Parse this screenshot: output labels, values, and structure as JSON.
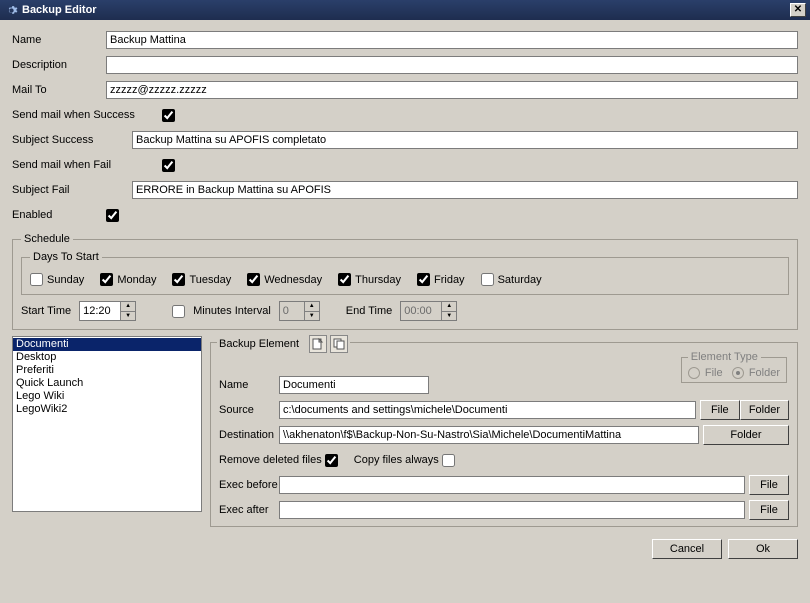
{
  "window": {
    "title": "Backup Editor"
  },
  "form": {
    "name_label": "Name",
    "name_value": "Backup Mattina",
    "desc_label": "Description",
    "desc_value": "",
    "mailto_label": "Mail To",
    "mailto_value": "zzzzz@zzzzz.zzzzz",
    "send_success_label": "Send mail when Success",
    "send_success_checked": true,
    "subject_success_label": "Subject Success",
    "subject_success_value": "Backup Mattina su APOFIS completato",
    "send_fail_label": "Send mail when Fail",
    "send_fail_checked": true,
    "subject_fail_label": "Subject Fail",
    "subject_fail_value": "ERRORE in Backup Mattina su APOFIS",
    "enabled_label": "Enabled",
    "enabled_checked": true
  },
  "schedule": {
    "legend": "Schedule",
    "days_legend": "Days To Start",
    "days": [
      {
        "label": "Sunday",
        "checked": false
      },
      {
        "label": "Monday",
        "checked": true
      },
      {
        "label": "Tuesday",
        "checked": true
      },
      {
        "label": "Wednesday",
        "checked": true
      },
      {
        "label": "Thursday",
        "checked": true
      },
      {
        "label": "Friday",
        "checked": true
      },
      {
        "label": "Saturday",
        "checked": false
      }
    ],
    "start_time_label": "Start Time",
    "start_time_value": "12:20",
    "minutes_interval_label": "Minutes Interval",
    "minutes_interval_value": "0",
    "minutes_interval_enabled": false,
    "end_time_label": "End Time",
    "end_time_value": "00:00",
    "end_time_enabled": false
  },
  "list": {
    "items": [
      "Documenti",
      "Desktop",
      "Preferiti",
      "Quick Launch",
      "Lego Wiki",
      "LegoWiki2"
    ],
    "selected_index": 0
  },
  "backup_element": {
    "legend": "Backup Element",
    "name_label": "Name",
    "name_value": "Documenti",
    "source_label": "Source",
    "source_value": "c:\\documents and settings\\michele\\Documenti",
    "destination_label": "Destination",
    "destination_value": "\\\\akhenaton\\f$\\Backup-Non-Su-Nastro\\Sia\\Michele\\DocumentiMattina",
    "remove_deleted_label": "Remove deleted files",
    "remove_deleted_checked": true,
    "copy_always_label": "Copy files always",
    "copy_always_checked": false,
    "exec_before_label": "Exec before",
    "exec_before_value": "",
    "exec_after_label": "Exec after",
    "exec_after_value": "",
    "btn_file": "File",
    "btn_folder": "Folder"
  },
  "element_type": {
    "legend": "Element Type",
    "file_label": "File",
    "folder_label": "Folder",
    "selected": "Folder"
  },
  "footer": {
    "cancel": "Cancel",
    "ok": "Ok"
  }
}
